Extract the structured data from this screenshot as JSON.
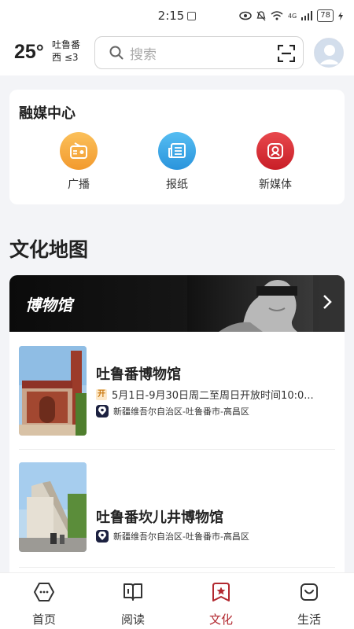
{
  "status": {
    "time": "2:15",
    "battery": "78",
    "network": "4G"
  },
  "header": {
    "temperature": "25°",
    "city": "吐鲁番",
    "wind": "西  ≤3",
    "search_placeholder": "搜索"
  },
  "media_center": {
    "title": "融媒中心",
    "items": [
      {
        "label": "广播",
        "icon": "radio-icon",
        "color": "#f6a63a"
      },
      {
        "label": "报纸",
        "icon": "newspaper-icon",
        "color": "#3aa8e8"
      },
      {
        "label": "新媒体",
        "icon": "new-media-icon",
        "color": "#d8333a"
      }
    ]
  },
  "culture_map": {
    "title": "文化地图",
    "category": "博物馆",
    "museums": [
      {
        "name": "吐鲁番博物馆",
        "open_badge": "开",
        "hours": "5月1日-9月30日周二至周日开放时间10:0...",
        "address": "新疆维吾尔自治区-吐鲁番市-高昌区"
      },
      {
        "name": "吐鲁番坎儿井博物馆",
        "address": "新疆维吾尔自治区-吐鲁番市-高昌区"
      }
    ]
  },
  "tabs": [
    {
      "label": "首页",
      "icon": "home-icon",
      "active": false
    },
    {
      "label": "阅读",
      "icon": "book-icon",
      "active": false
    },
    {
      "label": "文化",
      "icon": "culture-icon",
      "active": true
    },
    {
      "label": "生活",
      "icon": "life-icon",
      "active": false
    }
  ],
  "colors": {
    "accent": "#b2282f",
    "background": "#f3f4f7"
  }
}
